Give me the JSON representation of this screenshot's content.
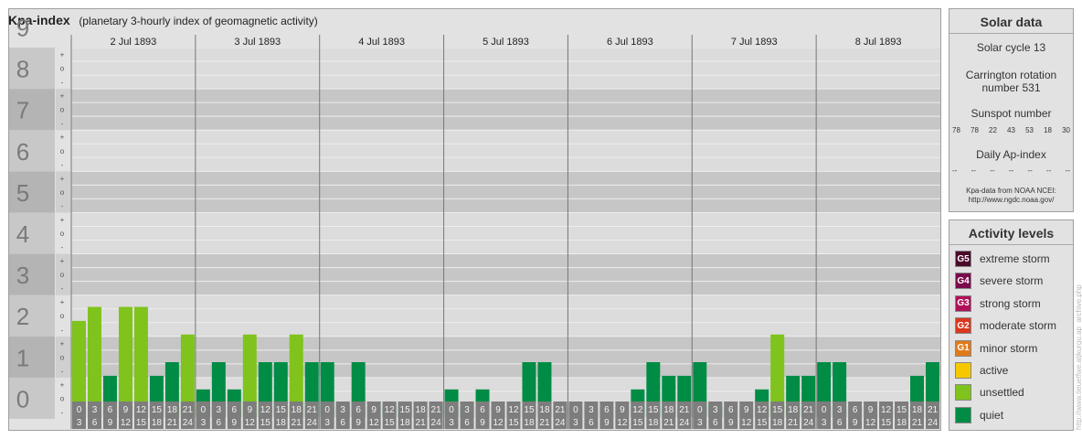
{
  "header": {
    "title": "Kpa-index",
    "subtitle": "(planetary 3-hourly index of geomagnetic activity)"
  },
  "chart_data": {
    "type": "bar",
    "ylim": [
      0,
      9
    ],
    "y_ticks": [
      "0",
      "1",
      "2",
      "3",
      "4",
      "5",
      "6",
      "7",
      "8",
      "9"
    ],
    "sub_ticks": [
      "-",
      "o",
      "+"
    ],
    "days": [
      "2 Jul 1893",
      "3 Jul 1893",
      "4 Jul 1893",
      "5 Jul 1893",
      "6 Jul 1893",
      "7 Jul 1893",
      "8 Jul 1893"
    ],
    "hour_slots": [
      [
        "0",
        "3"
      ],
      [
        "3",
        "6"
      ],
      [
        "6",
        "9"
      ],
      [
        "9",
        "12"
      ],
      [
        "12",
        "15"
      ],
      [
        "15",
        "18"
      ],
      [
        "18",
        "21"
      ],
      [
        "21",
        "24"
      ]
    ],
    "values": [
      [
        2.33,
        2.67,
        1.0,
        2.67,
        2.67,
        1.0,
        1.33,
        2.0
      ],
      [
        0.67,
        1.33,
        0.67,
        2.0,
        1.33,
        1.33,
        2.0,
        1.33
      ],
      [
        1.33,
        0.33,
        1.33,
        0.0,
        0.33,
        0.33,
        0.33,
        0.33
      ],
      [
        0.67,
        0.33,
        0.67,
        0.0,
        0.33,
        1.33,
        1.33,
        0.33
      ],
      [
        0.0,
        0.0,
        0.0,
        0.0,
        0.67,
        1.33,
        1.0,
        1.0
      ],
      [
        1.33,
        0.33,
        0.0,
        0.0,
        0.67,
        2.0,
        1.0,
        1.0
      ],
      [
        1.33,
        1.33,
        0.0,
        0.0,
        0.33,
        0.33,
        1.0,
        1.33
      ]
    ],
    "colors": {
      "quiet": "#008c45",
      "unsettled": "#7fc31c",
      "band_dark": "#c6c6c6",
      "band_light": "#dcdcdc",
      "axis_bg": "#bdbdbd",
      "axis_digit": "#7a7a7a",
      "hour_cell": "#7d7d7d"
    }
  },
  "solar": {
    "title": "Solar data",
    "cycle": "Solar cycle 13",
    "carrington_line1": "Carrington rotation",
    "carrington_line2": "number 531",
    "sunspot_label": "Sunspot number",
    "sunspot_values": [
      "78",
      "78",
      "22",
      "43",
      "53",
      "18",
      "30"
    ],
    "ap_label": "Daily Ap-index",
    "ap_values": [
      "--",
      "--",
      "--",
      "--",
      "--",
      "--",
      "--"
    ],
    "source_line1": "Kpa-data from NOAA NCEI:",
    "source_line2": "http://www.ngdc.noaa.gov/"
  },
  "activity": {
    "title": "Activity levels",
    "levels": [
      {
        "code": "G5",
        "label": "extreme storm",
        "color": "#4a0a2a"
      },
      {
        "code": "G4",
        "label": "severe storm",
        "color": "#7a0a4a"
      },
      {
        "code": "G3",
        "label": "strong storm",
        "color": "#b0105a"
      },
      {
        "code": "G2",
        "label": "moderate storm",
        "color": "#d9381e"
      },
      {
        "code": "G1",
        "label": "minor storm",
        "color": "#e07b1a"
      },
      {
        "code": "",
        "label": "active",
        "color": "#f5c800"
      },
      {
        "code": "",
        "label": "unsettled",
        "color": "#7fc31c"
      },
      {
        "code": "",
        "label": "quiet",
        "color": "#008c45"
      }
    ]
  },
  "watermark": "http://www.tieuetfwe.atjkurgu.ap_archive.php"
}
